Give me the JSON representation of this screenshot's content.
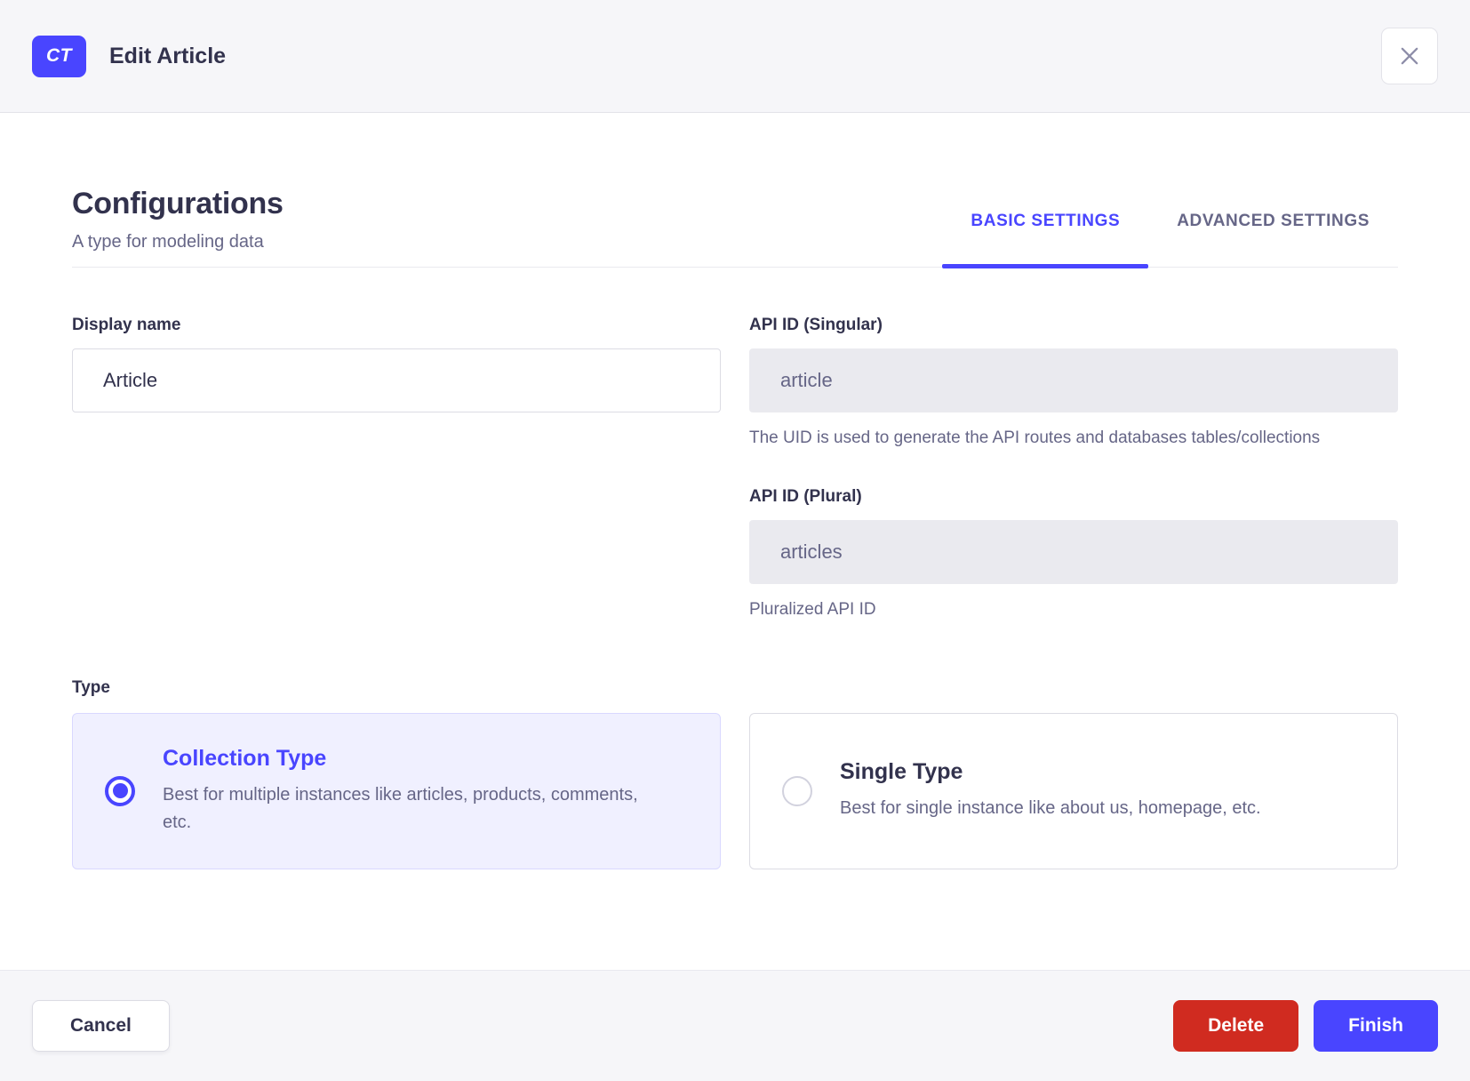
{
  "colors": {
    "primary": "#4945ff",
    "primary_card_bg": "#f0f0ff",
    "danger": "#d02b20",
    "text_dark": "#32324d",
    "text_muted": "#666687",
    "border": "#dcdce4",
    "surface_gray": "#f6f6f9",
    "disabled_bg": "#eaeaef"
  },
  "header": {
    "badge": "CT",
    "title": "Edit Article"
  },
  "config": {
    "title": "Configurations",
    "subtitle": "A type for modeling data",
    "tabs": [
      {
        "label": "BASIC SETTINGS",
        "active": true
      },
      {
        "label": "ADVANCED SETTINGS",
        "active": false
      }
    ]
  },
  "form": {
    "display_name": {
      "label": "Display name",
      "value": "Article"
    },
    "api_id_singular": {
      "label": "API ID (Singular)",
      "value": "article",
      "hint": "The UID is used to generate the API routes and databases tables/collections"
    },
    "api_id_plural": {
      "label": "API ID (Plural)",
      "value": "articles",
      "hint": "Pluralized API ID"
    },
    "type_label": "Type",
    "type_options": [
      {
        "title": "Collection Type",
        "description": "Best for multiple instances like articles, products, comments, etc.",
        "selected": true
      },
      {
        "title": "Single Type",
        "description": "Best for single instance like about us, homepage, etc.",
        "selected": false
      }
    ]
  },
  "footer": {
    "cancel_label": "Cancel",
    "delete_label": "Delete",
    "finish_label": "Finish"
  }
}
